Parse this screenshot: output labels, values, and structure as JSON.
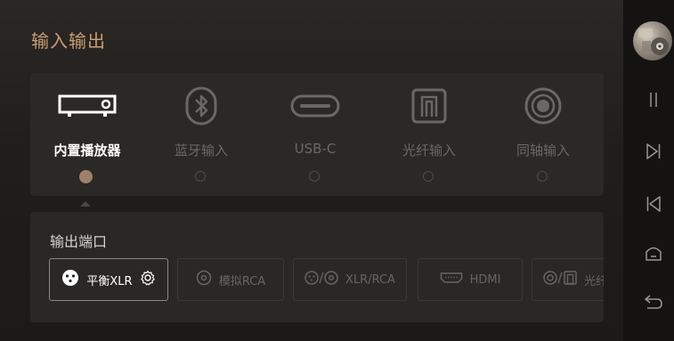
{
  "page": {
    "title": "输入输出"
  },
  "input_sources": [
    {
      "label": "内置播放器",
      "icon": "built-in-player-icon",
      "selected": true
    },
    {
      "label": "蓝牙输入",
      "icon": "bluetooth-icon",
      "selected": false
    },
    {
      "label": "USB-C",
      "icon": "usb-c-icon",
      "selected": false
    },
    {
      "label": "光纤输入",
      "icon": "optical-icon",
      "selected": false
    },
    {
      "label": "同轴输入",
      "icon": "coaxial-icon",
      "selected": false
    }
  ],
  "output": {
    "title": "输出端口",
    "ports": [
      {
        "label": "平衡XLR",
        "icon": "xlr-icon",
        "selected": true,
        "settings_icon": "gear-icon"
      },
      {
        "label": "模拟RCA",
        "icon": "rca-icon",
        "selected": false
      },
      {
        "label": "XLR/RCA",
        "icon": "xlr-rca-icon",
        "selected": false
      },
      {
        "label": "HDMI",
        "icon": "hdmi-icon",
        "selected": false
      },
      {
        "label": "光纤",
        "icon": "optical-coaxial-icon",
        "selected": false
      }
    ]
  },
  "controls": [
    {
      "name": "pause",
      "icon": "pause-icon"
    },
    {
      "name": "next",
      "icon": "next-icon"
    },
    {
      "name": "previous",
      "icon": "previous-icon"
    },
    {
      "name": "home",
      "icon": "home-icon"
    },
    {
      "name": "back",
      "icon": "back-icon"
    }
  ],
  "colors": {
    "accent": "#c99e72",
    "selected_radio": "#a0806a",
    "panel": "#2b2926",
    "background": "#1a1918"
  }
}
